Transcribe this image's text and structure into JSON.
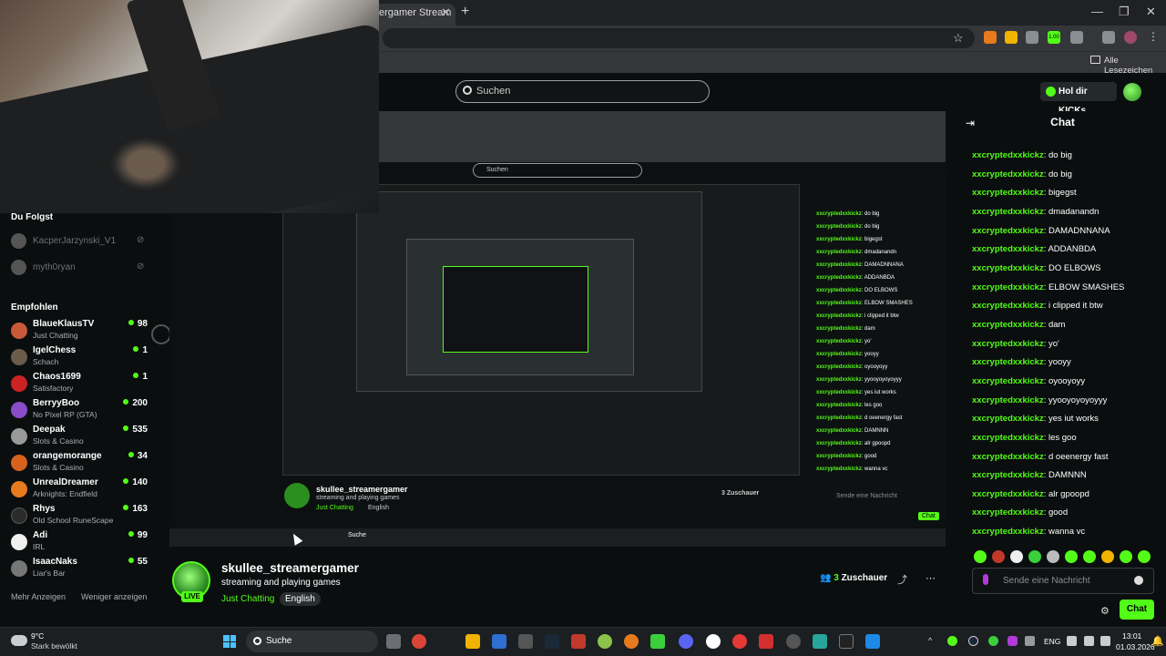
{
  "browser": {
    "tab_title": "ergamer Stream",
    "bookmarks_label": "Alle Lesezeichen",
    "ext_badge": "1.00"
  },
  "header": {
    "search_placeholder": "Suchen",
    "promo_label": "Hol dir KICKs"
  },
  "sidebar": {
    "following_heading": "Du Folgst",
    "following": [
      {
        "name": "KacperJarzynski_V1"
      },
      {
        "name": "myth0ryan"
      }
    ],
    "recommended_heading": "Empfohlen",
    "recommended": [
      {
        "name": "BlaueKlausTV",
        "category": "Just Chatting",
        "viewers": "98",
        "color": "#c85a3a"
      },
      {
        "name": "IgelChess",
        "category": "Schach",
        "viewers": "1",
        "color": "#6b5b4b"
      },
      {
        "name": "Chaos1699",
        "category": "Satisfactory",
        "viewers": "1",
        "color": "#cc2222"
      },
      {
        "name": "BerryyBoo",
        "category": "No Pixel RP (GTA)",
        "viewers": "200",
        "color": "#8a4cc9"
      },
      {
        "name": "Deepak",
        "category": "Slots & Casino",
        "viewers": "535",
        "color": "#999999"
      },
      {
        "name": "orangemorange",
        "category": "Slots & Casino",
        "viewers": "34",
        "color": "#d6621e"
      },
      {
        "name": "UnrealDreamer",
        "category": "Arknights: Endfield",
        "viewers": "140",
        "color": "#e87a1e"
      },
      {
        "name": "Rhys",
        "category": "Old School RuneScape",
        "viewers": "163",
        "color": "#2b2b2b"
      },
      {
        "name": "Adi",
        "category": "IRL",
        "viewers": "99",
        "color": "#f0f0f0"
      },
      {
        "name": "IsaacNaks",
        "category": "Liar's Bar",
        "viewers": "55",
        "color": "#777777"
      }
    ],
    "show_more": "Mehr Anzeigen",
    "show_less": "Weniger anzeigen"
  },
  "nested": {
    "search": "Suchen",
    "streamer": "skullee_streamergamer",
    "subtitle": "streaming and playing games",
    "category": "Just Chatting",
    "language": "English",
    "viewers": "3 Zuschauer",
    "taskbar_search": "Suche",
    "chat_placeholder": "Sende eine Nachricht",
    "chat_send": "Chat"
  },
  "chat": {
    "title": "Chat",
    "messages": [
      {
        "user": "xxcryptedxxkickz",
        "text": "do big"
      },
      {
        "user": "xxcryptedxxkickz",
        "text": "do big"
      },
      {
        "user": "xxcryptedxxkickz",
        "text": "bigegst"
      },
      {
        "user": "xxcryptedxxkickz",
        "text": "dmadanandn"
      },
      {
        "user": "xxcryptedxxkickz",
        "text": "DAMADNNANA"
      },
      {
        "user": "xxcryptedxxkickz",
        "text": "ADDANBDA"
      },
      {
        "user": "xxcryptedxxkickz",
        "text": "DO ELBOWS"
      },
      {
        "user": "xxcryptedxxkickz",
        "text": "ELBOW SMASHES"
      },
      {
        "user": "xxcryptedxxkickz",
        "text": "i clipped it btw"
      },
      {
        "user": "xxcryptedxxkickz",
        "text": "dam"
      },
      {
        "user": "xxcryptedxxkickz",
        "text": "yo'"
      },
      {
        "user": "xxcryptedxxkickz",
        "text": "yooyy"
      },
      {
        "user": "xxcryptedxxkickz",
        "text": "oyooyoyy"
      },
      {
        "user": "xxcryptedxxkickz",
        "text": "yyooyoyoyoyyy"
      },
      {
        "user": "xxcryptedxxkickz",
        "text": "yes iut works"
      },
      {
        "user": "xxcryptedxxkickz",
        "text": "les goo"
      },
      {
        "user": "xxcryptedxxkickz",
        "text": "d oeenergy fast"
      },
      {
        "user": "xxcryptedxxkickz",
        "text": "DAMNNN"
      },
      {
        "user": "xxcryptedxxkickz",
        "text": "alr gpoopd"
      },
      {
        "user": "xxcryptedxxkickz",
        "text": "good"
      },
      {
        "user": "xxcryptedxxkickz",
        "text": "wanna vc"
      }
    ],
    "input_placeholder": "Sende eine Nachricht",
    "send_label": "Chat"
  },
  "stream": {
    "name": "skullee_streamergamer",
    "title": "streaming and playing games",
    "category": "Just Chatting",
    "language": "English",
    "live_badge": "LIVE",
    "viewers_count": "3",
    "viewers_label": "Zuschauer"
  },
  "taskbar": {
    "weather_temp": "9°C",
    "weather_desc": "Stark bewölkt",
    "search_label": "Suche",
    "lang": "ENG",
    "time": "13:01",
    "date": "01.03.2026"
  },
  "colors": {
    "kick_green": "#53fc18",
    "background": "#0b0e0f"
  }
}
